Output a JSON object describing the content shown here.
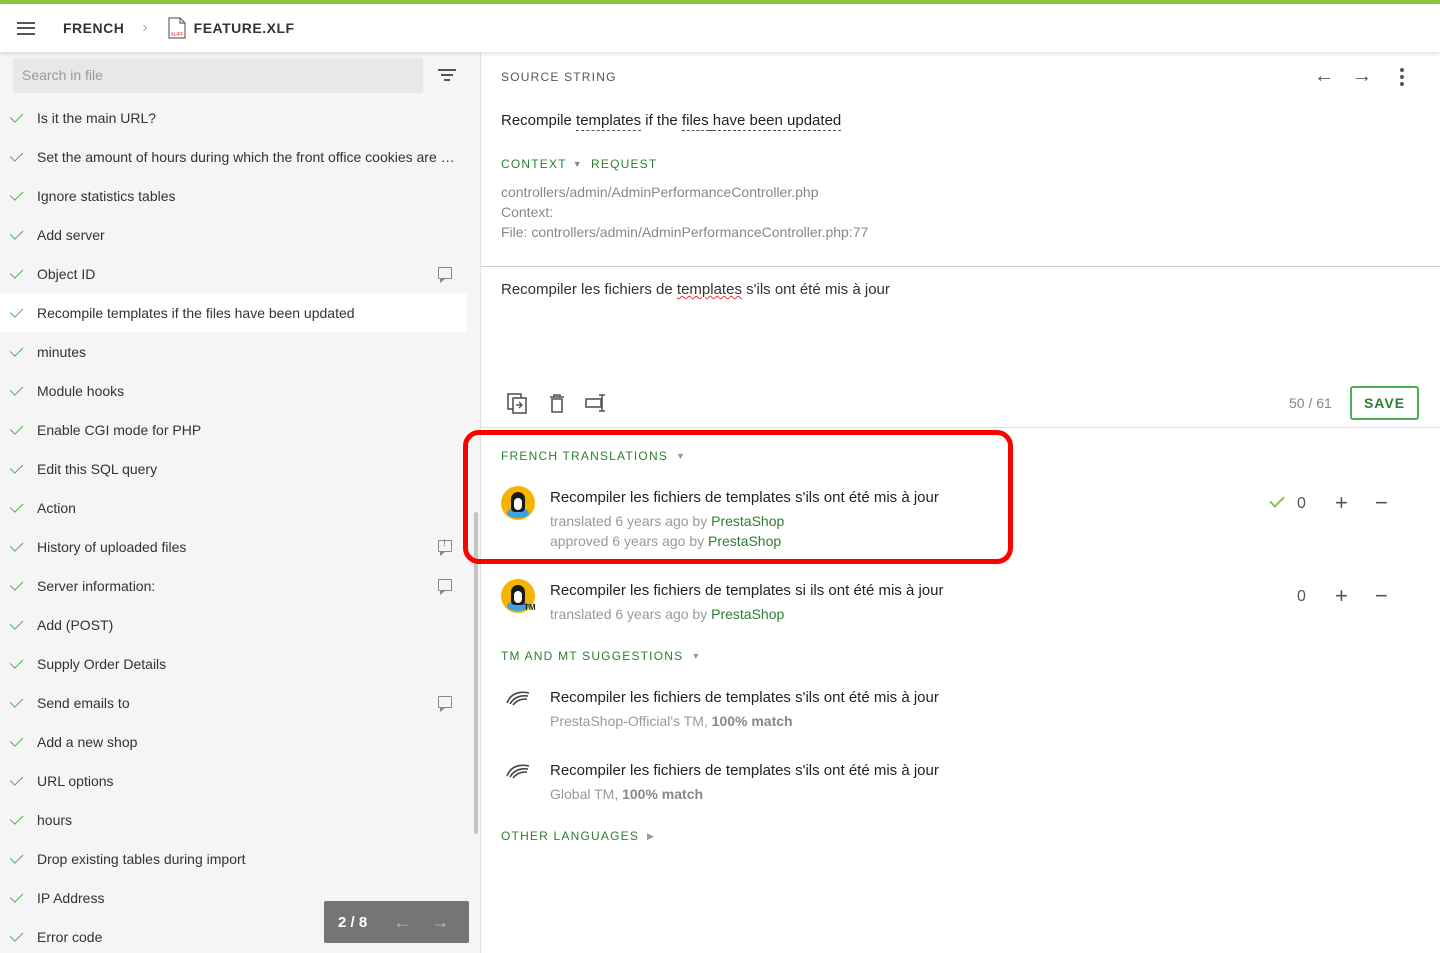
{
  "topbar": {
    "language": "FRENCH",
    "file_name": "FEATURE.XLF",
    "file_icon_label": "XLIFF"
  },
  "sidebar": {
    "search_placeholder": "Search in file",
    "items": [
      {
        "label": "Is it the main URL?",
        "comment": "none"
      },
      {
        "label": "Set the amount of hours during which the front office cookies are valid. After that amount of time, the customer will have to log in again.",
        "comment": "none"
      },
      {
        "label": "Ignore statistics tables",
        "comment": "none"
      },
      {
        "label": "Add server",
        "comment": "none"
      },
      {
        "label": "Object ID",
        "comment": "comment"
      },
      {
        "label": "Recompile templates if the files have been updated",
        "comment": "none",
        "active": true
      },
      {
        "label": "minutes",
        "comment": "none"
      },
      {
        "label": "Module hooks",
        "comment": "none"
      },
      {
        "label": "Enable CGI mode for PHP",
        "comment": "none"
      },
      {
        "label": "Edit this SQL query",
        "comment": "none"
      },
      {
        "label": "Action",
        "comment": "none"
      },
      {
        "label": "History of uploaded files",
        "comment": "alert"
      },
      {
        "label": "Server information:",
        "comment": "comment"
      },
      {
        "label": "Add (POST)",
        "comment": "none"
      },
      {
        "label": "Supply Order Details",
        "comment": "none"
      },
      {
        "label": "Send emails to",
        "comment": "comment"
      },
      {
        "label": "Add a new shop",
        "comment": "none"
      },
      {
        "label": "URL options",
        "comment": "none"
      },
      {
        "label": "hours",
        "comment": "none"
      },
      {
        "label": "Drop existing tables during import",
        "comment": "none"
      },
      {
        "label": "IP Address",
        "comment": "none"
      },
      {
        "label": "Error code",
        "comment": "none"
      }
    ],
    "pager": {
      "text": "2 / 8",
      "prev": "←",
      "next": "→"
    }
  },
  "source": {
    "label": "SOURCE STRING",
    "nav_prev": "←",
    "nav_next": "→",
    "text_parts": [
      "Recompile ",
      "templates",
      " if the ",
      "files",
      " ",
      "have been updated"
    ],
    "context_label": "CONTEXT",
    "request_label": "REQUEST",
    "context_lines": [
      "controllers/admin/AdminPerformanceController.php",
      "Context:",
      "File: controllers/admin/AdminPerformanceController.php:77"
    ]
  },
  "editor": {
    "text_before": "Recompiler les fichiers de ",
    "text_spell": "templates",
    "text_after": " s'ils ont été mis à jour",
    "char_count": "50 / 61",
    "save_label": "SAVE"
  },
  "translations": {
    "label": "FRENCH TRANSLATIONS",
    "items": [
      {
        "text": "Recompiler les fichiers de templates s'ils ont été mis à jour",
        "translated_prefix": "translated 6 years ago by ",
        "translated_by": "PrestaShop",
        "approved_prefix": "approved 6 years ago by ",
        "approved_by": "PrestaShop",
        "votes": "0",
        "approved": true,
        "plus": "+",
        "minus": "−"
      },
      {
        "text": "Recompiler les fichiers de templates si ils ont été mis à jour",
        "translated_prefix": "translated 6 years ago by ",
        "translated_by": "PrestaShop",
        "votes": "0",
        "approved": false,
        "tm_badge": "TM",
        "plus": "+",
        "minus": "−"
      }
    ]
  },
  "suggestions": {
    "label": "TM AND MT SUGGESTIONS",
    "items": [
      {
        "text": "Recompiler les fichiers de templates s'ils ont été mis à jour",
        "source": "PrestaShop-Official's TM, ",
        "match": "100% match"
      },
      {
        "text": "Recompiler les fichiers de templates s'ils ont été mis à jour",
        "source": "Global TM, ",
        "match": "100% match"
      }
    ]
  },
  "other_languages": {
    "label": "OTHER LANGUAGES"
  },
  "colors": {
    "accent": "#8dc63f",
    "green_text": "#2e7d32",
    "highlight": "#ff0000"
  }
}
